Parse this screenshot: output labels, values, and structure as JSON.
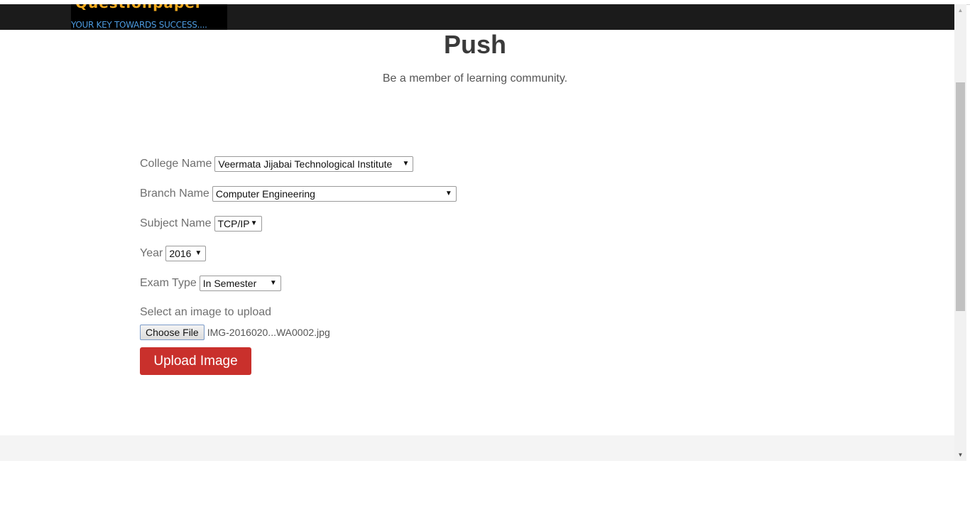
{
  "header": {
    "logo_name": "Questionpaper",
    "logo_tagline": "YOUR KEY TOWARDS SUCCESS...."
  },
  "page": {
    "title": "Push",
    "subtitle": "Be a member of learning community."
  },
  "form": {
    "college_label": "College Name",
    "college_value": "Veermata Jijabai Technological Institute",
    "branch_label": "Branch Name",
    "branch_value": "Computer Engineering",
    "subject_label": "Subject Name",
    "subject_value": "TCP/IP",
    "year_label": "Year",
    "year_value": "2016",
    "exam_label": "Exam Type",
    "exam_value": "In Semester",
    "upload_label": "Select an image to upload",
    "choose_file_label": "Choose File",
    "file_name": "IMG-2016020...WA0002.jpg",
    "submit_label": "Upload Image"
  },
  "colors": {
    "navbar": "#1b1b1b",
    "accent_button": "#c9302c",
    "logo_orange": "#f0a91c",
    "logo_blue": "#4d9be0"
  },
  "icons": {
    "dropdown": "caret-down-icon",
    "scroll_up": "scroll-up-arrow-icon",
    "scroll_down": "scroll-down-arrow-icon"
  }
}
